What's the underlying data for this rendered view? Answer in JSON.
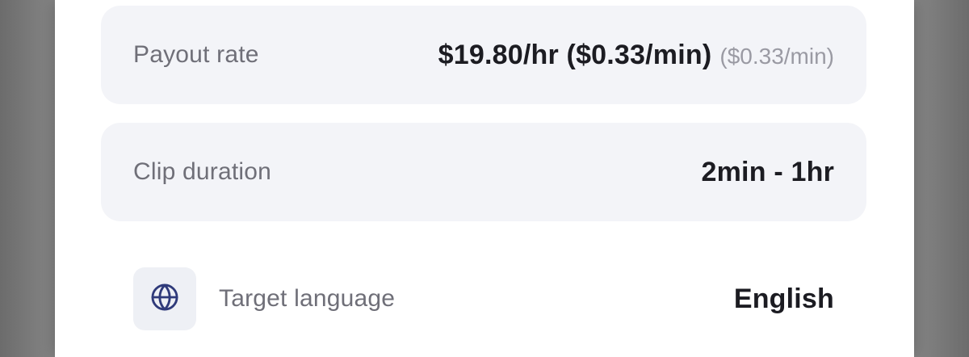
{
  "payout_row": {
    "label": "Payout rate",
    "value": "$19.80/hr ($0.33/min)",
    "secondary": "($0.33/min)"
  },
  "duration_row": {
    "label": "Clip duration",
    "value": "2min - 1hr"
  },
  "language_row": {
    "icon": "globe-icon",
    "label": "Target language",
    "value": "English"
  },
  "colors": {
    "card_background": "#f3f4f8",
    "icon_tile_background": "#eef0f5",
    "icon_color": "#2f3a7a",
    "primary_text": "#1c1c22",
    "secondary_text": "#6f6f78"
  }
}
